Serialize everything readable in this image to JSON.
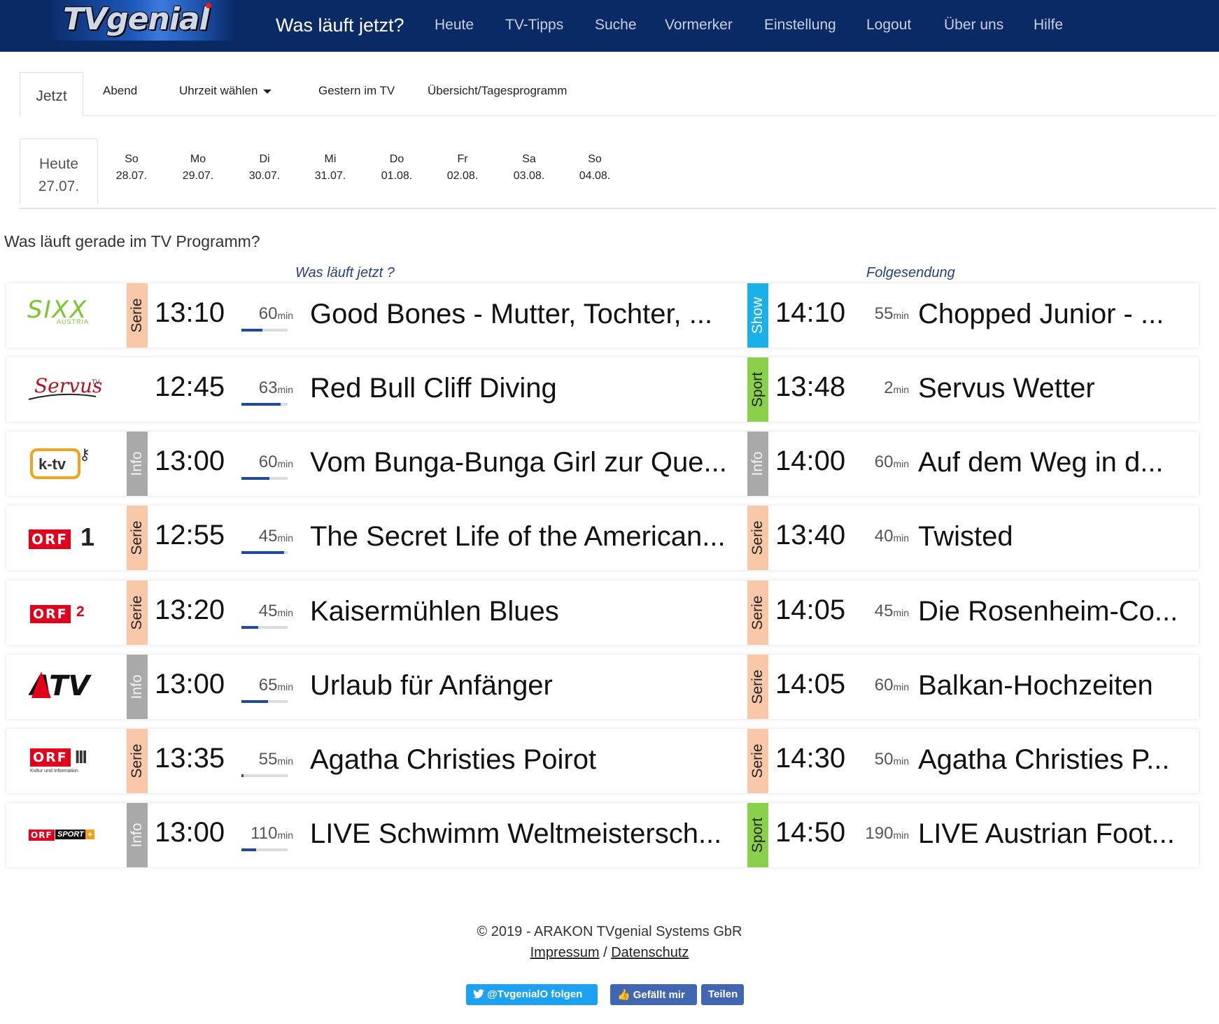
{
  "navbar": {
    "logo_text": "TVgenial",
    "brand_link": "Was läuft jetzt?",
    "links": [
      "Heute",
      "TV-Tipps",
      "Suche",
      "Vormerker",
      "Einstellung",
      "Logout",
      "Über uns",
      "Hilfe"
    ]
  },
  "tabs": {
    "active": "Jetzt",
    "items": [
      "Abend",
      "Uhrzeit wählen",
      "Gestern im TV",
      "Übersicht/Tagesprogramm"
    ]
  },
  "days": {
    "active": {
      "name": "Heute",
      "date": "27.07."
    },
    "items": [
      {
        "name": "So",
        "date": "28.07."
      },
      {
        "name": "Mo",
        "date": "29.07."
      },
      {
        "name": "Di",
        "date": "30.07."
      },
      {
        "name": "Mi",
        "date": "31.07."
      },
      {
        "name": "Do",
        "date": "01.08."
      },
      {
        "name": "Fr",
        "date": "02.08."
      },
      {
        "name": "Sa",
        "date": "03.08."
      },
      {
        "name": "So",
        "date": "04.08."
      }
    ]
  },
  "page_heading": "Was läuft gerade im TV Programm?",
  "col_now": "Was läuft jetzt ?",
  "col_next": "Folgesendung",
  "duration_unit": "min",
  "programs": [
    {
      "channel": "sixx Austria",
      "logo_text": "SIXX",
      "logo_sub": "AUSTRIA",
      "now": {
        "genre": "Serie",
        "time": "13:10",
        "duration": "60",
        "progress": 0.45,
        "title": "Good Bones - Mutter, Tochter, ..."
      },
      "next": {
        "genre": "Show",
        "time": "14:10",
        "duration": "55",
        "title": "Chopped Junior - ..."
      }
    },
    {
      "channel": "ServusTV",
      "logo_text": "Servus",
      "logo_sub": "TV",
      "now": {
        "genre": "",
        "time": "12:45",
        "duration": "63",
        "progress": 0.85,
        "title": "Red Bull Cliff Diving"
      },
      "next": {
        "genre": "Sport",
        "time": "13:48",
        "duration": "2",
        "title": "Servus Wetter"
      }
    },
    {
      "channel": "k-tv",
      "logo_text": "k-tv",
      "logo_sub": "",
      "now": {
        "genre": "Info",
        "time": "13:00",
        "duration": "60",
        "progress": 0.6,
        "title": "Vom Bunga-Bunga Girl zur Que..."
      },
      "next": {
        "genre": "Info",
        "time": "14:00",
        "duration": "60",
        "title": "Auf dem Weg in d..."
      }
    },
    {
      "channel": "ORF 1",
      "logo_text": "ORF",
      "logo_sub": "1",
      "now": {
        "genre": "Serie",
        "time": "12:55",
        "duration": "45",
        "progress": 0.92,
        "title": "The Secret Life of the American..."
      },
      "next": {
        "genre": "Serie",
        "time": "13:40",
        "duration": "40",
        "title": "Twisted"
      }
    },
    {
      "channel": "ORF 2",
      "logo_text": "ORF",
      "logo_sub": "2",
      "now": {
        "genre": "Serie",
        "time": "13:20",
        "duration": "45",
        "progress": 0.36,
        "title": "Kaisermühlen Blues"
      },
      "next": {
        "genre": "Serie",
        "time": "14:05",
        "duration": "45",
        "title": "Die Rosenheim-Co..."
      }
    },
    {
      "channel": "ATV",
      "logo_text": "ATV",
      "logo_sub": "",
      "now": {
        "genre": "Info",
        "time": "13:00",
        "duration": "65",
        "progress": 0.57,
        "title": "Urlaub für Anfänger"
      },
      "next": {
        "genre": "Serie",
        "time": "14:05",
        "duration": "60",
        "title": "Balkan-Hochzeiten"
      }
    },
    {
      "channel": "ORF III",
      "logo_text": "ORF",
      "logo_sub": "Kultur und Information",
      "now": {
        "genre": "Serie",
        "time": "13:35",
        "duration": "55",
        "progress": 0.04,
        "title": "Agatha Christies Poirot"
      },
      "next": {
        "genre": "Serie",
        "time": "14:30",
        "duration": "50",
        "title": "Agatha Christies P..."
      }
    },
    {
      "channel": "ORF Sport +",
      "logo_text": "ORF",
      "logo_sub": "SPORT",
      "now": {
        "genre": "Info",
        "time": "13:00",
        "duration": "110",
        "progress": 0.32,
        "title": "LIVE Schwimm Weltmeistersch..."
      },
      "next": {
        "genre": "Sport",
        "time": "14:50",
        "duration": "190",
        "title": "LIVE Austrian Foot..."
      }
    }
  ],
  "footer": {
    "copyright": "© 2019 - ARAKON TVgenial Systems GbR",
    "impressum": "Impressum",
    "separator": "/",
    "datenschutz": "Datenschutz",
    "twitter_label": "@TvgenialO folgen",
    "like_label": "Gefällt mir",
    "share_label": "Teilen"
  },
  "colors": {
    "navbar": "#0a2a66",
    "serie": "#f8c8a8",
    "info": "#a9a9a9",
    "show": "#1ab0e8",
    "sport": "#8bd04a",
    "progress": "#1f4a9e"
  }
}
